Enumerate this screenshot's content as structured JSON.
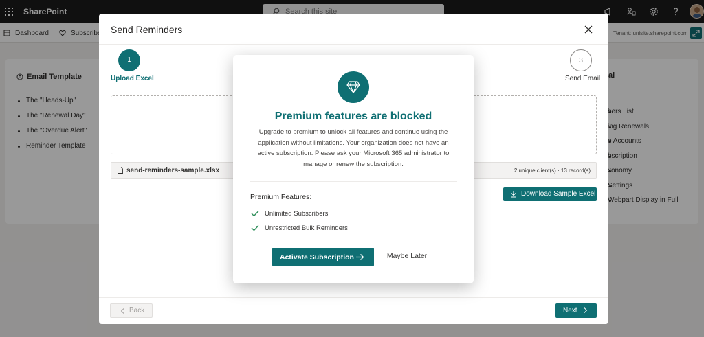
{
  "suitebar": {
    "title": "SharePoint",
    "search_placeholder": "Search this site"
  },
  "navbar": {
    "items": [
      "Dashboard",
      "Subscribe"
    ],
    "tenant": "Tenant: unisite.sharepoint.com"
  },
  "email_template": {
    "title": "Email Template",
    "items": [
      "The \"Heads-Up\"",
      "The \"Renewal Day\"",
      "The \"Overdue Alert\"",
      "Reminder Template"
    ]
  },
  "right_menu": {
    "title_fragment": "al",
    "items": [
      "bers List",
      "ing Renewals",
      "e Accounts",
      "bscription",
      "xonomy",
      " Settings",
      "Webpart Display in Full"
    ]
  },
  "panel": {
    "title": "Send Reminders",
    "steps": [
      {
        "number": "1",
        "label": "Upload Excel"
      },
      {
        "number": "3",
        "label": "Send Email"
      }
    ],
    "file_name": "send-reminders-sample.xlsx",
    "file_summary": "2 unique client(s) · 13 record(s)",
    "download_label": "Download Sample Excel",
    "back_label": "Back",
    "next_label": "Next"
  },
  "modal": {
    "title": "Premium features are blocked",
    "description": "Upgrade to premium to unlock all features and continue using the application without limitations. Your organization does not have an active subscription. Please ask your Microsoft 365 administrator to manage or renew the subscription.",
    "features_heading": "Premium Features:",
    "features": [
      "Unlimited Subscribers",
      "Unrestricted Bulk Reminders"
    ],
    "activate_label": "Activate Subscription",
    "later_label": "Maybe Later"
  },
  "colors": {
    "accent": "#0f6f73",
    "suitebar": "#1b1b1b",
    "check": "#2f8f5b"
  }
}
